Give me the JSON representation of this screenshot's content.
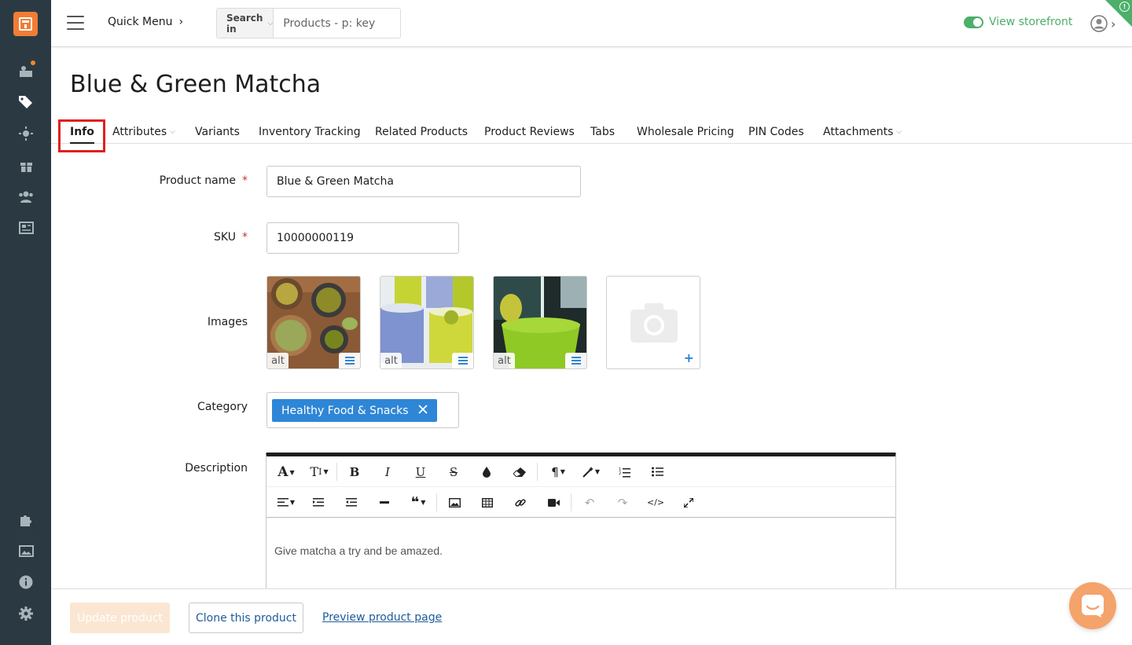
{
  "topbar": {
    "quick_menu_label": "Quick Menu",
    "search_in_label": "Search in",
    "search_placeholder": "Products - p: key",
    "storefront_label": "View storefront"
  },
  "sidebar": {
    "items": [
      {
        "name": "dashboard",
        "icon": "chart-user-icon",
        "has_notification": true
      },
      {
        "name": "products",
        "icon": "tags-icon",
        "active": true
      },
      {
        "name": "design",
        "icon": "sun-icon"
      },
      {
        "name": "marketing",
        "icon": "gift-icon"
      },
      {
        "name": "customers",
        "icon": "users-icon"
      },
      {
        "name": "website",
        "icon": "newspaper-icon"
      },
      {
        "name": "addons",
        "icon": "puzzle-icon"
      },
      {
        "name": "media",
        "icon": "image-icon"
      },
      {
        "name": "help",
        "icon": "info-icon"
      },
      {
        "name": "settings",
        "icon": "gear-icon"
      }
    ]
  },
  "page": {
    "title": "Blue & Green Matcha"
  },
  "tabs": [
    {
      "label": "Info",
      "active": true
    },
    {
      "label": "Attributes",
      "dropdown": true
    },
    {
      "label": "Variants"
    },
    {
      "label": "Inventory Tracking"
    },
    {
      "label": "Related Products"
    },
    {
      "label": "Product Reviews"
    },
    {
      "label": "Tabs"
    },
    {
      "label": "Wholesale Pricing"
    },
    {
      "label": "PIN Codes"
    },
    {
      "label": "Attachments",
      "dropdown": true
    }
  ],
  "form": {
    "product_name_label": "Product name",
    "product_name_value": "Blue & Green Matcha",
    "sku_label": "SKU",
    "sku_value": "10000000119",
    "required_mark": "*",
    "images_label": "Images",
    "alt_label": "alt",
    "category_label": "Category",
    "category_chip": "Healthy Food & Snacks",
    "description_label": "Description",
    "description_text": "Give matcha a try and be amazed."
  },
  "footer": {
    "update_label": "Update product",
    "clone_label": "Clone this product",
    "preview_label": "Preview product page"
  },
  "colors": {
    "sidebar": "#2b3a42",
    "brand_orange": "#f07d35",
    "accent_blue": "#2f86d6",
    "success_green": "#4caf6a",
    "highlight_red": "#e02020"
  }
}
